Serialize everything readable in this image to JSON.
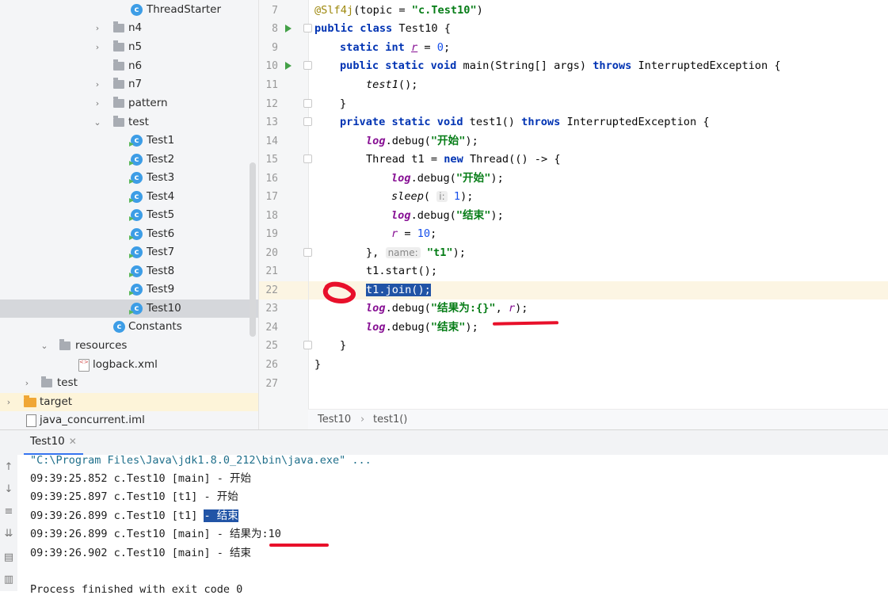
{
  "tree": {
    "items": [
      {
        "label": "ThreadStarter",
        "kind": "class",
        "arrow": ""
      },
      {
        "label": "n4",
        "kind": "pkg",
        "arrow": "›"
      },
      {
        "label": "n5",
        "kind": "pkg",
        "arrow": "›"
      },
      {
        "label": "n6",
        "kind": "pkg",
        "arrow": ""
      },
      {
        "label": "n7",
        "kind": "pkg",
        "arrow": "›"
      },
      {
        "label": "pattern",
        "kind": "pkg",
        "arrow": "›"
      },
      {
        "label": "test",
        "kind": "pkg",
        "arrow": "⌄"
      },
      {
        "label": "Test1",
        "kind": "class-run",
        "arrow": ""
      },
      {
        "label": "Test2",
        "kind": "class-run",
        "arrow": ""
      },
      {
        "label": "Test3",
        "kind": "class-run",
        "arrow": ""
      },
      {
        "label": "Test4",
        "kind": "class-run",
        "arrow": ""
      },
      {
        "label": "Test5",
        "kind": "class-run",
        "arrow": ""
      },
      {
        "label": "Test6",
        "kind": "class-run",
        "arrow": ""
      },
      {
        "label": "Test7",
        "kind": "class-run",
        "arrow": ""
      },
      {
        "label": "Test8",
        "kind": "class-run",
        "arrow": ""
      },
      {
        "label": "Test9",
        "kind": "class-run",
        "arrow": ""
      },
      {
        "label": "Test10",
        "kind": "class-run",
        "arrow": "",
        "selected": true
      },
      {
        "label": "Constants",
        "kind": "class",
        "arrow": ""
      },
      {
        "label": "resources",
        "kind": "pkg",
        "arrow": "⌄"
      },
      {
        "label": "logback.xml",
        "kind": "xml",
        "arrow": ""
      },
      {
        "label": "test",
        "kind": "pkg",
        "arrow": "›"
      },
      {
        "label": "target",
        "kind": "folder",
        "arrow": "›"
      },
      {
        "label": "java_concurrent.iml",
        "kind": "iml",
        "arrow": ""
      }
    ]
  },
  "editor": {
    "line_numbers": [
      "7",
      "8",
      "9",
      "10",
      "11",
      "12",
      "13",
      "14",
      "15",
      "16",
      "17",
      "18",
      "19",
      "20",
      "21",
      "22",
      "23",
      "24",
      "25",
      "26",
      "27"
    ],
    "code": {
      "l7_ann": "@Slf4j",
      "l7_a": "(topic = ",
      "l7_str": "\"c.Test10\"",
      "l7_b": ")",
      "l8_kw": "public class",
      "l8_rest": " Test10 {",
      "l9_kw": "static int",
      "l9_fld": "r",
      "l9_eq": " = ",
      "l9_num": "0",
      "l9_end": ";",
      "l10_kw1": "public static void",
      "l10_mid": " main(String[] args) ",
      "l10_kw2": "throws",
      "l10_end": " InterruptedException {",
      "l11_call": "test1",
      "l11_end": "();",
      "l12": "}",
      "l13_kw1": "private static void",
      "l13_mid": " test1() ",
      "l13_kw2": "throws",
      "l13_end": " InterruptedException {",
      "log": "log",
      "debug_open": ".debug(",
      "close": ");",
      "str_start": "\"开始\"",
      "l15_a": "Thread t1 = ",
      "l15_kw": "new",
      "l15_b": " Thread(() -> {",
      "l17_sleep": "sleep",
      "l17_open": "(",
      "l17_hint": "i:",
      "l17_num": "1",
      "str_end": "\"结束\"",
      "l19_eq": " = ",
      "l19_num": "10",
      "l19_semi": ";",
      "l20_a": "},",
      "l20_hint": "name:",
      "l20_str": "\"t1\"",
      "l20_end": ");",
      "l21": "t1.start();",
      "l22": "t1.join();",
      "l23_str": "\"结果为:{}\"",
      "l23_comma": ", ",
      "l23_fld": "r",
      "l23_end": ");",
      "l25": "}",
      "l26": "}"
    }
  },
  "breadcrumb": {
    "class": "Test10",
    "method": "test1()"
  },
  "run": {
    "tab_label": "Test10",
    "command": "\"C:\\Program Files\\Java\\jdk1.8.0_212\\bin\\java.exe\" ...",
    "lines": [
      {
        "pre": "09:39:25.852 c.Test10 [main] - ",
        "msg": "开始"
      },
      {
        "pre": "09:39:25.897 c.Test10 [t1] - ",
        "msg": "开始"
      },
      {
        "pre": "09:39:26.899 c.Test10 [t1] ",
        "msg": "- 结束"
      },
      {
        "pre": "09:39:26.899 c.Test10 [main] - ",
        "msg": "结果为:10"
      },
      {
        "pre": "09:39:26.902 c.Test10 [main] - ",
        "msg": "结束"
      }
    ],
    "exit": "Process finished with exit code 0"
  },
  "colors": {
    "accent": "#3574f0",
    "selection": "#2154a6",
    "annotation_red": "#e8102a"
  }
}
